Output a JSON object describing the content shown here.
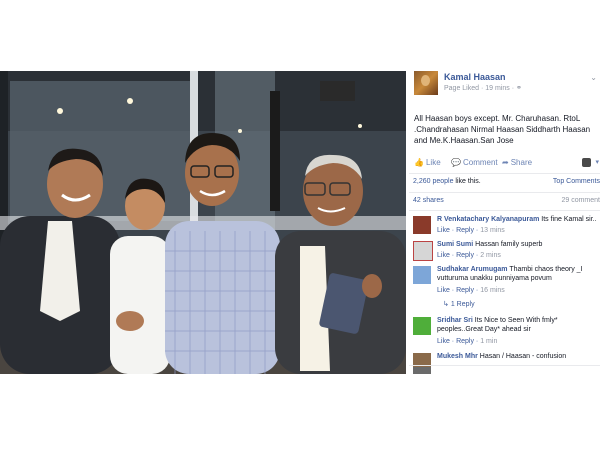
{
  "post": {
    "author": "Kamal Haasan",
    "meta": "Page Liked · 19 mins ·",
    "text": "All Haasan boys except. Mr. Charuhasan. RtoL .Chandrahasan Nirmal Haasan Siddharth Haasan and Me.K.Haasan.San Jose",
    "actions": {
      "like": "Like",
      "comment": "Comment",
      "share": "Share"
    },
    "likes_count": "2,260 people",
    "likes_suffix": " like this.",
    "top_comments": "Top Comments",
    "shares": "42 shares",
    "comments_count": "29 comment",
    "comments": [
      {
        "name": "R Venkatachary Kalyanapuram",
        "text": "Its fine Kamal sir..",
        "like": "Like",
        "reply": "Reply",
        "time": "13 mins"
      },
      {
        "name": "Sumi Sumi",
        "text": "Hassan family superb",
        "like": "Like",
        "reply": "Reply",
        "time": "2 mins"
      },
      {
        "name": "Sudhakar Arumugam",
        "text": "Thambi chaos theory _I vutturuma unakku punniyama povum",
        "like": "Like",
        "reply": "Reply",
        "time": "16 mins"
      },
      {
        "name": "Sridhar Sri",
        "text": "Its Nice to Seen With fmly* peoples..Great Day* ahead sir",
        "like": "Like",
        "reply": "Reply",
        "time": "1 min"
      },
      {
        "name": "Mukesh Mhr",
        "text": "Hasan / Haasan - confusion"
      }
    ],
    "reply_link": "1 Reply"
  },
  "colors": {
    "fb_blue": "#3b5998",
    "link_blue": "#6d84b4",
    "meta_gray": "#9197a3"
  },
  "icons": [
    "like-thumb-icon",
    "comment-bubble-icon",
    "share-arrow-icon",
    "globe-icon",
    "chevron-down-icon",
    "reply-arrow-icon"
  ]
}
